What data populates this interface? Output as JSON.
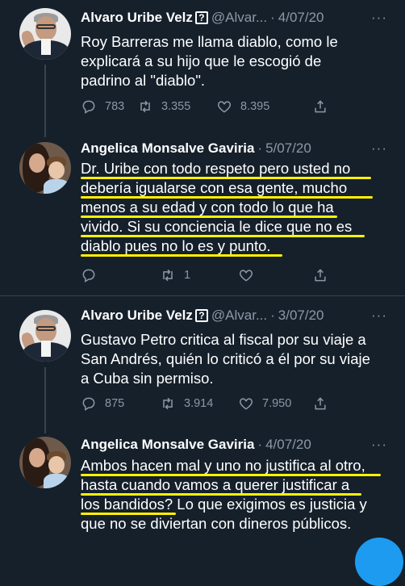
{
  "tweets": [
    {
      "name": "Alvaro Uribe Velz",
      "verified_mark": "?",
      "handle": "@Alvar...",
      "separator": "·",
      "date": "4/07/20",
      "text": "Roy Barreras me llama diablo, como le\nexplicará a su hijo que le escogió de\npadrino al \"diablo\".",
      "replies": "783",
      "retweets": "3.355",
      "likes": "8.395"
    },
    {
      "name": "Angelica Monsalve Gaviria",
      "separator": "·",
      "date": "5/07/20",
      "lines": [
        "Dr. Uribe con todo respeto pero usted no",
        "debería igualarse con esa gente, mucho",
        "menos a su edad y con todo lo que ha",
        "vivido. Si su conciencia le dice que no es",
        "diablo pues no lo es y punto."
      ],
      "replies": "",
      "retweets": "1",
      "likes": ""
    },
    {
      "name": "Alvaro Uribe Velz",
      "verified_mark": "?",
      "handle": "@Alvar...",
      "separator": "·",
      "date": "3/07/20",
      "text": "Gustavo Petro critica al fiscal por su viaje a\nSan Andrés, quién lo criticó a él por su viaje\na Cuba sin permiso.",
      "replies": "875",
      "retweets": "3.914",
      "likes": "7.950"
    },
    {
      "name": "Angelica Monsalve Gaviria",
      "separator": "·",
      "date": "4/07/20",
      "lines": [
        "Ambos hacen mal y uno no justifica al otro,",
        "hasta cuando vamos a querer justificar a",
        "los bandidos? Lo que exigimos es justicia y",
        "que no se diviertan con dineros públicos."
      ]
    }
  ],
  "more_label": "···",
  "colors": {
    "background": "#15202b",
    "highlight": "#fff200",
    "muted": "#8b98a5",
    "accent": "#1d9bf0"
  },
  "icons": [
    "reply-icon",
    "retweet-icon",
    "like-icon",
    "share-icon"
  ]
}
